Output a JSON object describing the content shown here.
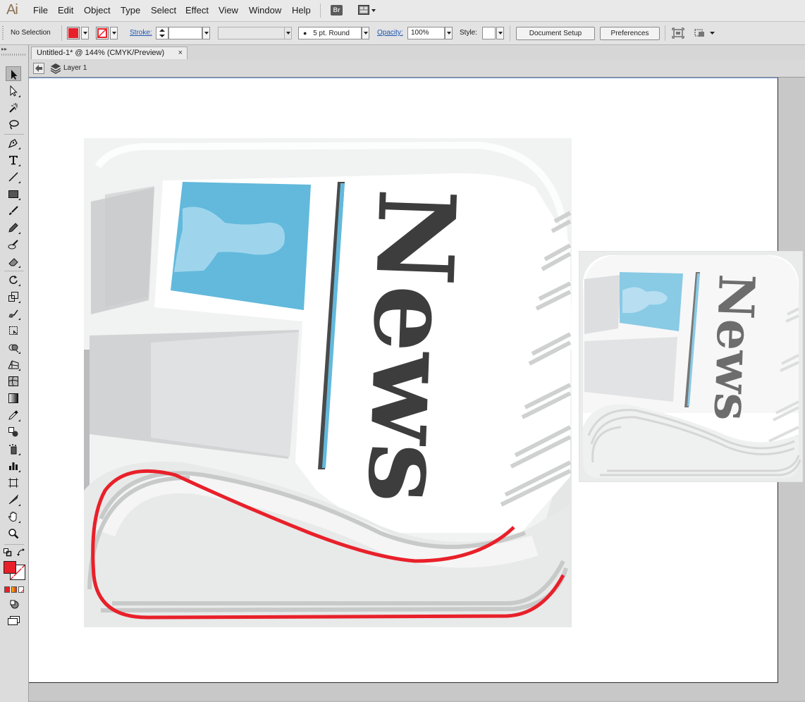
{
  "app": {
    "logo": "Ai"
  },
  "menu": {
    "items": [
      "File",
      "Edit",
      "Object",
      "Type",
      "Select",
      "Effect",
      "View",
      "Window",
      "Help"
    ],
    "bridge_label": "Br"
  },
  "control_bar": {
    "selection_status": "No Selection",
    "fill_color": "#e8202a",
    "stroke_label": "Stroke:",
    "brush_label": "5 pt. Round",
    "opacity_label": "Opacity:",
    "opacity_value": "100%",
    "style_label": "Style:",
    "document_setup_label": "Document Setup",
    "preferences_label": "Preferences"
  },
  "document": {
    "tab_title": "Untitled-1* @ 144% (CMYK/Preview)",
    "tab_close": "×",
    "layer_name": "Layer 1"
  },
  "artwork": {
    "masthead_text": "News",
    "colors": {
      "accent_red": "#e8202a",
      "photo_blue": "#62b9dc",
      "ink_dark": "#3d3d3d",
      "paper_gray": "#d8d9d9"
    }
  },
  "toolbox": {
    "fill_color": "#e8202a",
    "tools": [
      "selection-tool-icon",
      "direct-selection-tool-icon",
      "magic-wand-tool-icon",
      "lasso-tool-icon",
      "pen-tool-icon",
      "type-tool-icon",
      "line-tool-icon",
      "rectangle-tool-icon",
      "paintbrush-tool-icon",
      "pencil-tool-icon",
      "blob-brush-tool-icon",
      "eraser-tool-icon",
      "rotate-tool-icon",
      "scale-tool-icon",
      "warp-tool-icon",
      "free-transform-tool-icon",
      "shape-builder-tool-icon",
      "perspective-grid-tool-icon",
      "mesh-tool-icon",
      "gradient-tool-icon",
      "eyedropper-tool-icon",
      "blend-tool-icon",
      "symbol-sprayer-tool-icon",
      "column-graph-tool-icon",
      "artboard-tool-icon",
      "slice-tool-icon",
      "hand-tool-icon",
      "zoom-tool-icon"
    ]
  }
}
